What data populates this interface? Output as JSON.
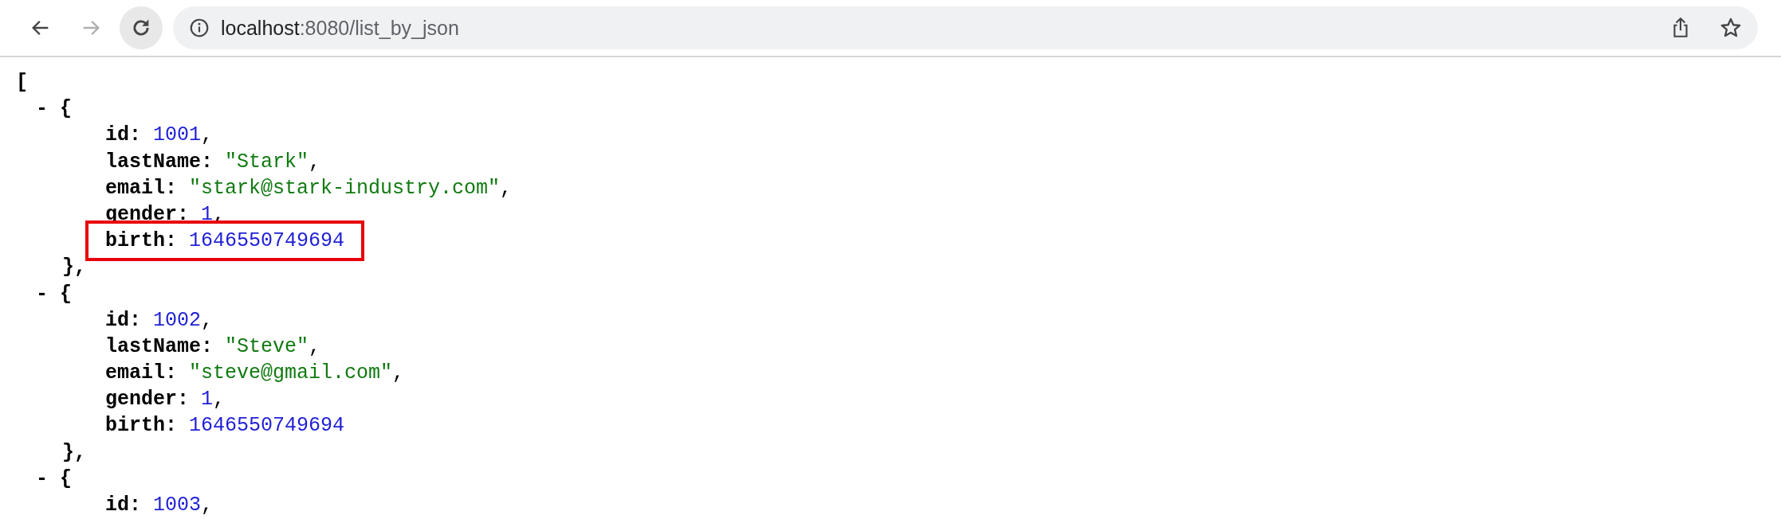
{
  "toolbar": {
    "nav": [
      {
        "kind": "back",
        "disabled": false,
        "hovered": false
      },
      {
        "kind": "forward",
        "disabled": true,
        "hovered": false
      },
      {
        "kind": "reload",
        "disabled": false,
        "hovered": true
      }
    ],
    "address": {
      "host": "localhost",
      "rest": ":8080/list_by_json"
    }
  },
  "json": {
    "open": "[",
    "items": [
      {
        "marker": "- {",
        "close": "},",
        "fields": [
          {
            "key": "id:",
            "value": "1001",
            "kind": "number",
            "punct": ",",
            "highlighted": false
          },
          {
            "key": "lastName:",
            "value": "\"Stark\"",
            "kind": "string",
            "punct": ",",
            "highlighted": false
          },
          {
            "key": "email:",
            "value": "\"stark@stark-industry.com\"",
            "kind": "string",
            "punct": ",",
            "highlighted": false
          },
          {
            "key": "gender:",
            "value": "1",
            "kind": "number",
            "punct": ",",
            "highlighted": false
          },
          {
            "key": "birth:",
            "value": "1646550749694",
            "kind": "number",
            "highlighted": true
          }
        ]
      },
      {
        "marker": "- {",
        "close": "},",
        "fields": [
          {
            "key": "id:",
            "value": "1002",
            "kind": "number",
            "punct": ",",
            "highlighted": false
          },
          {
            "key": "lastName:",
            "value": "\"Steve\"",
            "kind": "string",
            "punct": ",",
            "highlighted": false
          },
          {
            "key": "email:",
            "value": "\"steve@gmail.com\"",
            "kind": "string",
            "punct": ",",
            "highlighted": false
          },
          {
            "key": "gender:",
            "value": "1",
            "kind": "number",
            "punct": ",",
            "highlighted": false
          },
          {
            "key": "birth:",
            "value": "1646550749694",
            "kind": "number",
            "highlighted": false
          }
        ]
      },
      {
        "marker": "- {",
        "fields": [
          {
            "key": "id:",
            "value": "1003",
            "kind": "number",
            "punct": ",",
            "highlighted": false
          }
        ]
      }
    ]
  }
}
